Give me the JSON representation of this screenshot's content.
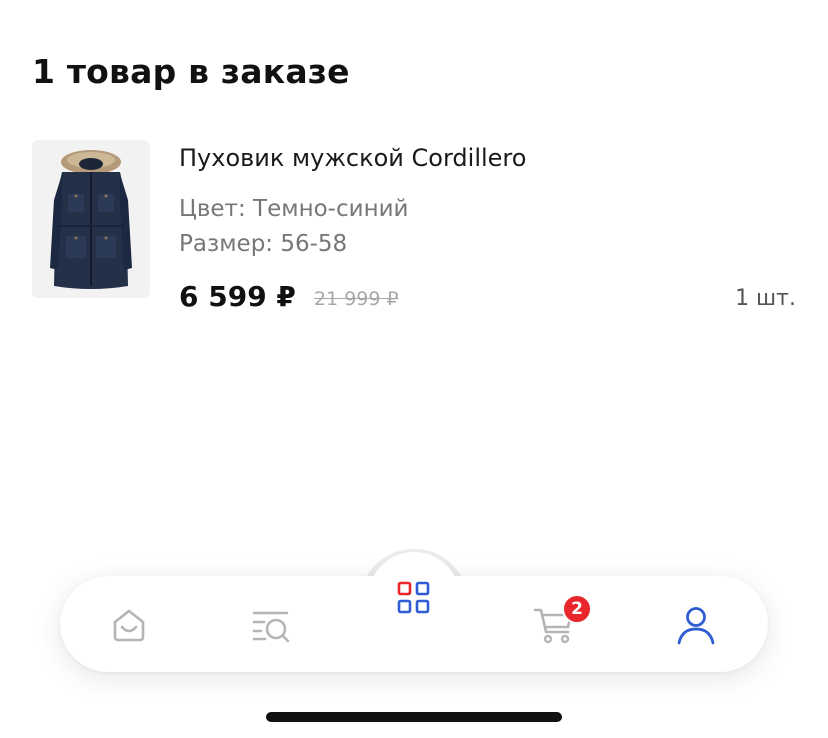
{
  "order": {
    "title": "1 товар в заказе"
  },
  "product": {
    "image_icon": "parka-jacket-image",
    "name": "Пуховик мужской Cordillero",
    "color_attr": "Цвет: Темно-синий",
    "size_attr": "Размер: 56-58",
    "price": "6 599 ₽",
    "old_price": "21 999 ₽",
    "quantity": "1 шт."
  },
  "nav": {
    "items": [
      {
        "icon": "home-icon",
        "active": false
      },
      {
        "icon": "catalog-search-icon",
        "active": false
      },
      {
        "icon": "catalog-grid-icon",
        "active": false
      },
      {
        "icon": "cart-icon",
        "active": false
      },
      {
        "icon": "profile-icon",
        "active": true
      }
    ],
    "cart_badge": "2"
  },
  "colors": {
    "accent_blue": "#2f5bd3",
    "accent_red": "#e8262b",
    "icon_gray": "#b5b5b5"
  }
}
